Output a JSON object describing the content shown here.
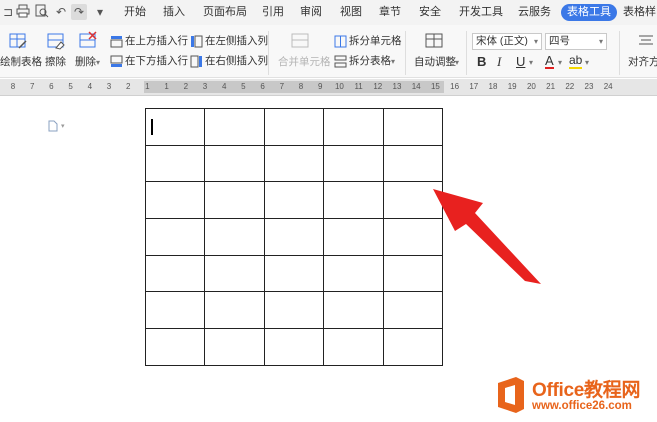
{
  "menu": {
    "items": [
      "开始",
      "插入",
      "页面布局",
      "引用",
      "审阅",
      "视图",
      "章节",
      "安全",
      "开发工具",
      "云服务",
      "表格工具",
      "表格样"
    ],
    "active_index": 10
  },
  "ribbon": {
    "draw_table": "绘制表格",
    "erase": "擦除",
    "delete": "删除",
    "insert_row_above": "在上方插入行",
    "insert_row_below": "在下方插入行",
    "insert_col_left": "在左侧插入列",
    "insert_col_right": "在右侧插入列",
    "merge_cells": "合并单元格",
    "split_cells": "拆分单元格",
    "split_table": "拆分表格",
    "auto_adjust": "自动调整",
    "font_name": "宋体 (正文)",
    "font_size": "四号",
    "bold": "B",
    "italic": "I",
    "underline": "U",
    "font_color": "A",
    "highlight": "ab",
    "align": "对齐方"
  },
  "ruler": {
    "ticks": [
      "8",
      "7",
      "6",
      "5",
      "4",
      "3",
      "2",
      "1",
      "1",
      "2",
      "3",
      "4",
      "5",
      "6",
      "7",
      "8",
      "9",
      "10",
      "11",
      "12",
      "13",
      "14",
      "15",
      "16",
      "17",
      "18",
      "19",
      "20",
      "21",
      "22",
      "23",
      "24"
    ]
  },
  "table": {
    "rows": 7,
    "cols": 5
  },
  "watermark": {
    "title": "Office教程网",
    "url": "www.office26.com"
  },
  "colors": {
    "accent": "#3b78e7",
    "arrow": "#e8211f",
    "logo": "#e8641b"
  }
}
